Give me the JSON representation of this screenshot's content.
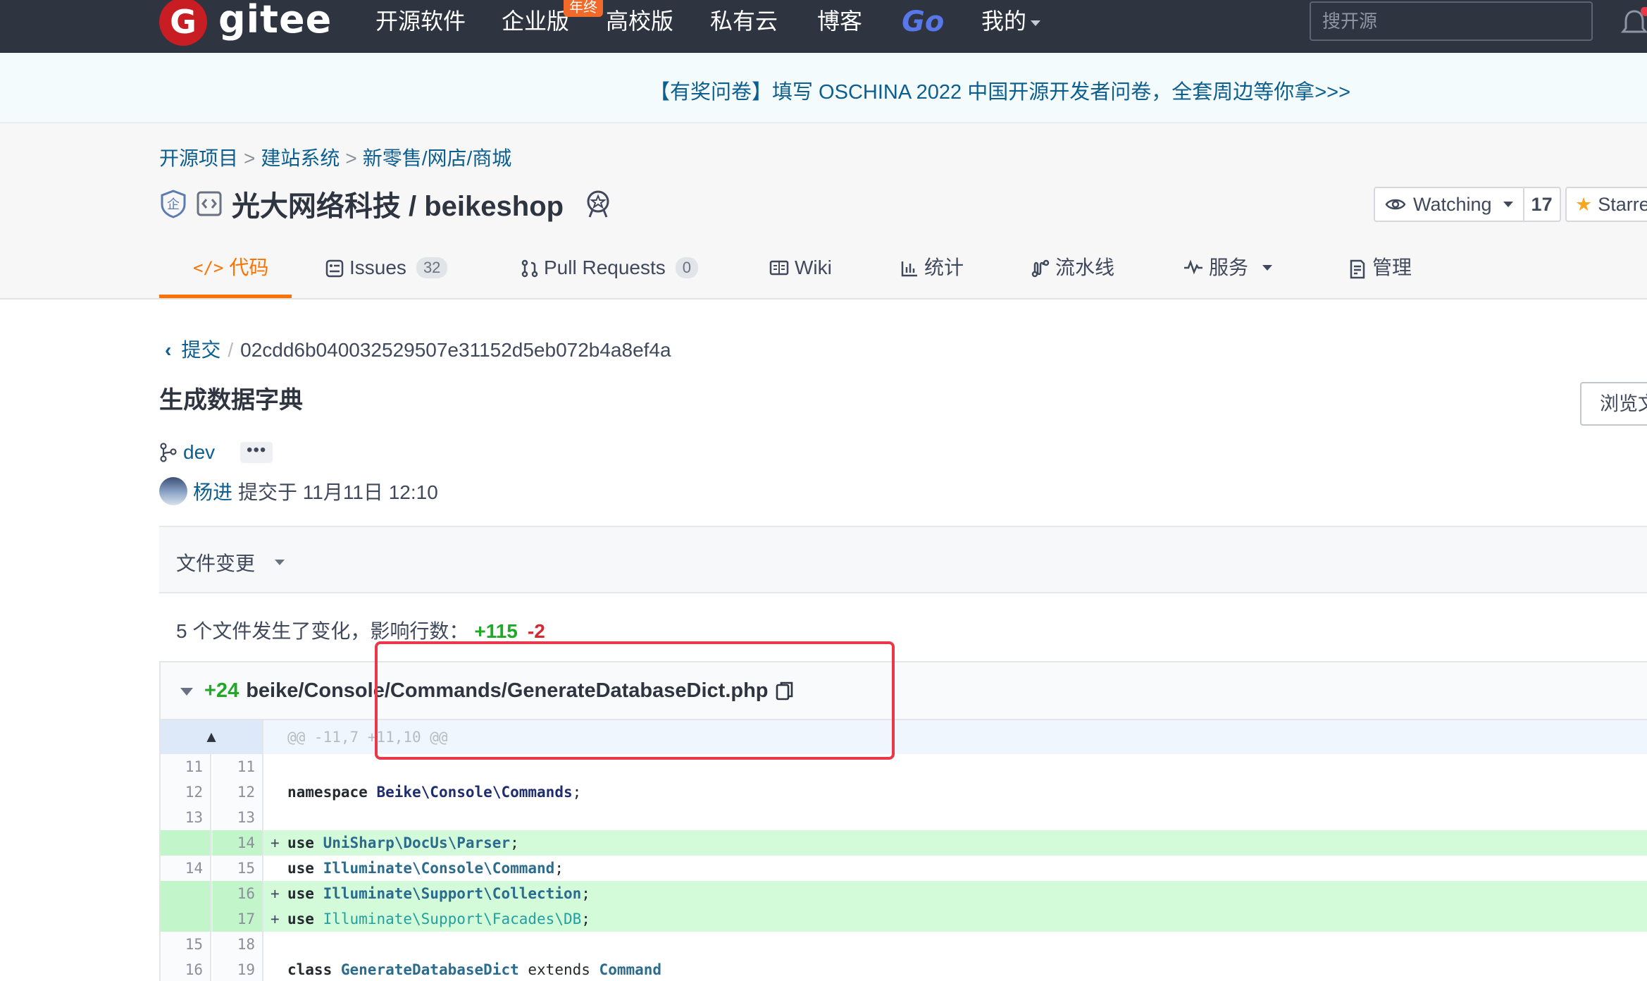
{
  "navbar": {
    "logo_text": "gitee",
    "items": [
      {
        "label": "开源软件"
      },
      {
        "label": "企业版"
      },
      {
        "label": "高校版"
      },
      {
        "label": "私有云"
      },
      {
        "label": "博客"
      },
      {
        "label": "Go"
      },
      {
        "label": "我的"
      }
    ],
    "badge": "年终",
    "search_placeholder": "搜开源"
  },
  "banner": {
    "text": "【有奖问卷】填写 OSCHINA 2022 中国开源开发者问卷，全套周边等你拿>>>"
  },
  "breadcrumb": [
    "开源项目",
    "建站系统",
    "新零售/网店/商城"
  ],
  "repo": {
    "name": "光大网络科技 / beikeshop",
    "watch_label": "Watching",
    "watch_count": "17",
    "star_label": "Starred"
  },
  "tabs": [
    {
      "label": "代码",
      "active": true
    },
    {
      "label": "Issues",
      "count": "32"
    },
    {
      "label": "Pull Requests",
      "count": "0"
    },
    {
      "label": "Wiki"
    },
    {
      "label": "统计"
    },
    {
      "label": "流水线"
    },
    {
      "label": "服务"
    },
    {
      "label": "管理"
    }
  ],
  "commit": {
    "back_label": "提交",
    "sha": "02cdd6b040032529507e31152d5eb072b4a8ef4a",
    "title": "生成数据字典",
    "browse_label": "浏览文件",
    "branch": "dev",
    "more": "•••",
    "author": "杨进",
    "meta": "提交于 11月11日 12:10"
  },
  "file_changes": {
    "label": "文件变更",
    "summary_text": "5 个文件发生了变化，影响行数：",
    "additions": "+115",
    "deletions": "-2"
  },
  "diff": {
    "file_additions": "+24",
    "file_path": "beike/Console/Commands/GenerateDatabaseDict.php",
    "hunk": "@@ -11,7 +11,10 @@",
    "lines": [
      {
        "old": "11",
        "new": "11",
        "sign": "",
        "code": ""
      },
      {
        "old": "12",
        "new": "12",
        "sign": "",
        "code_kw": "namespace",
        "code_ns": "Beike\\Console\\Commands",
        "code_tail": ";"
      },
      {
        "old": "13",
        "new": "13",
        "sign": "",
        "code": ""
      },
      {
        "old": "",
        "new": "14",
        "sign": "+",
        "code_kw": "use",
        "code_ns": "UniSharp\\DocUs\\Parser",
        "code_tail": ";"
      },
      {
        "old": "14",
        "new": "15",
        "sign": "",
        "code_kw": "use",
        "code_ns": "Illuminate\\Console\\Command",
        "code_tail": ";"
      },
      {
        "old": "",
        "new": "16",
        "sign": "+",
        "code_kw": "use",
        "code_ns": "Illuminate\\Support\\Collection",
        "code_tail": ";"
      },
      {
        "old": "",
        "new": "17",
        "sign": "+",
        "code_kw": "use",
        "code_ns": "Illuminate\\Support\\Facades\\DB",
        "code_tail": ";"
      },
      {
        "old": "15",
        "new": "18",
        "sign": "",
        "code": ""
      },
      {
        "old": "16",
        "new": "19",
        "sign": "",
        "code_kw": "class",
        "code_ns": "GenerateDatabaseDict",
        "code_tail": " extends ",
        "code_cls2": "Command"
      }
    ]
  },
  "colors": {
    "navbar_bg": "#2e3440",
    "accent_orange": "#fe7300",
    "link_blue": "#0c5e8f",
    "add_green": "#22a827",
    "del_red": "#d6292f",
    "annotation_red": "#e8384a"
  }
}
